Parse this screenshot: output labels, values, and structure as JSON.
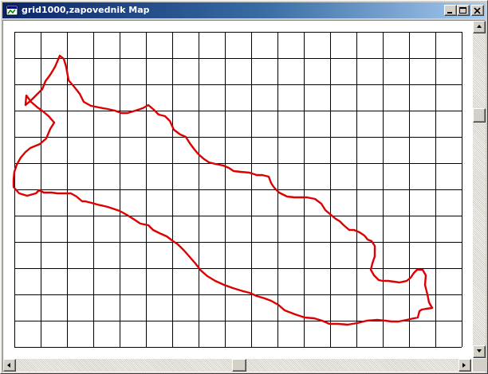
{
  "window": {
    "title": "grid1000,zapovednik Map",
    "icon": "map-window-icon"
  },
  "titlebar_buttons": {
    "minimize": "minimize-icon",
    "maximize": "maximize-icon",
    "close": "close-icon"
  },
  "map": {
    "grid_line_color": "#000000",
    "background_color": "#ffffff",
    "boundary_color": "#dd0000",
    "grid_columns": 17,
    "grid_rows": 12
  },
  "scrollbars": {
    "vertical_icons": [
      "scroll-up-icon",
      "scroll-down-icon"
    ],
    "horizontal_icons": [
      "scroll-left-icon",
      "scroll-right-icon"
    ]
  }
}
